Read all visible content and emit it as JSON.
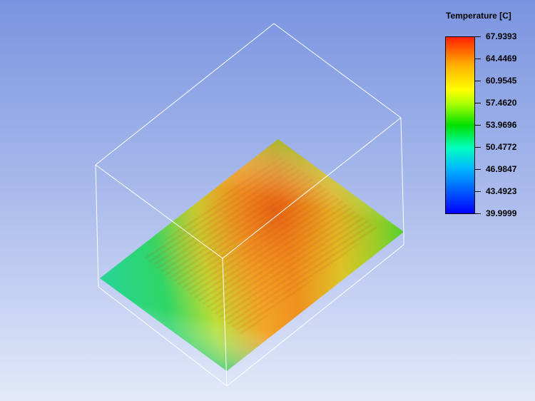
{
  "legend": {
    "title": "Temperature [C]",
    "labels": [
      "67.9393",
      "64.4469",
      "60.9545",
      "57.4620",
      "53.9696",
      "50.4772",
      "46.9847",
      "43.4923",
      "39.9999"
    ],
    "colors": [
      "#ff2000",
      "#ffb000",
      "#ffff00",
      "#a8ff00",
      "#00e000",
      "#00ffc0",
      "#00ffff",
      "#00b4ff",
      "#0000ff"
    ]
  },
  "scene": {
    "background_top": "#7a94e0",
    "background_bottom": "#e3e9f9",
    "outline_color": "#ffffff"
  }
}
